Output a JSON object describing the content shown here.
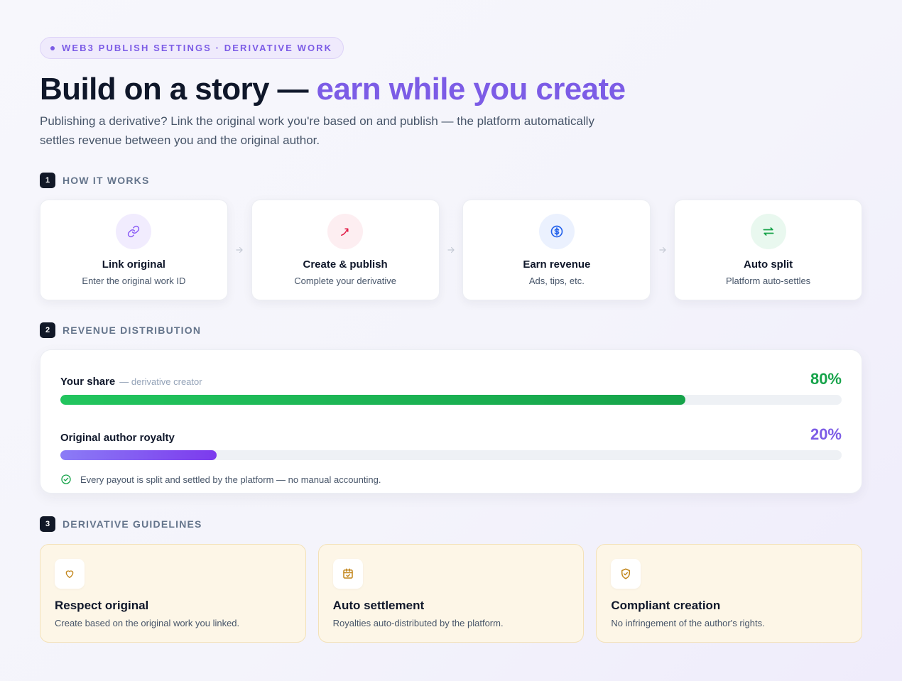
{
  "badge": {
    "text": "WEB3 PUBLISH SETTINGS · DERIVATIVE WORK"
  },
  "headline": {
    "main": "Build on a story — ",
    "accent": "earn while you create"
  },
  "lead": "Publishing a derivative? Link the original work you're based on and publish — the platform automatically settles revenue between you and the original author.",
  "how_it_works": {
    "number": "1",
    "title": "HOW IT WORKS",
    "steps": [
      {
        "title": "Link original",
        "subtitle": "Enter the original work ID",
        "icon": "link-icon",
        "color": "#8b5cf6"
      },
      {
        "title": "Create & publish",
        "subtitle": "Complete your derivative",
        "icon": "pen-icon",
        "color": "#e11d48"
      },
      {
        "title": "Earn revenue",
        "subtitle": "Ads, tips, etc.",
        "icon": "dollar-coin-icon",
        "color": "#2563eb"
      },
      {
        "title": "Auto split",
        "subtitle": "Platform auto-settles",
        "icon": "swap-arrows-icon",
        "color": "#16a34a"
      }
    ]
  },
  "revenue": {
    "number": "2",
    "title": "REVENUE DISTRIBUTION",
    "your_share": {
      "label": "Your share",
      "sub": "— derivative creator",
      "pct_text": "80%",
      "value": 0.8,
      "color": "#16a34a"
    },
    "royalty": {
      "label": "Original author royalty",
      "pct_text": "20%",
      "value": 0.2,
      "color": "#7c5ce6"
    },
    "note": "Every payout is split and settled by the platform — no manual accounting."
  },
  "guidelines": {
    "number": "3",
    "title": "DERIVATIVE GUIDELINES",
    "cards": [
      {
        "title": "Respect original",
        "subtitle": "Create based on the original work you linked.",
        "icon": "heart-icon"
      },
      {
        "title": "Auto settlement",
        "subtitle": "Royalties auto-distributed by the platform.",
        "icon": "calendar-check-icon"
      },
      {
        "title": "Compliant creation",
        "subtitle": "No infringement of the author's rights.",
        "icon": "shield-check-icon"
      }
    ]
  }
}
